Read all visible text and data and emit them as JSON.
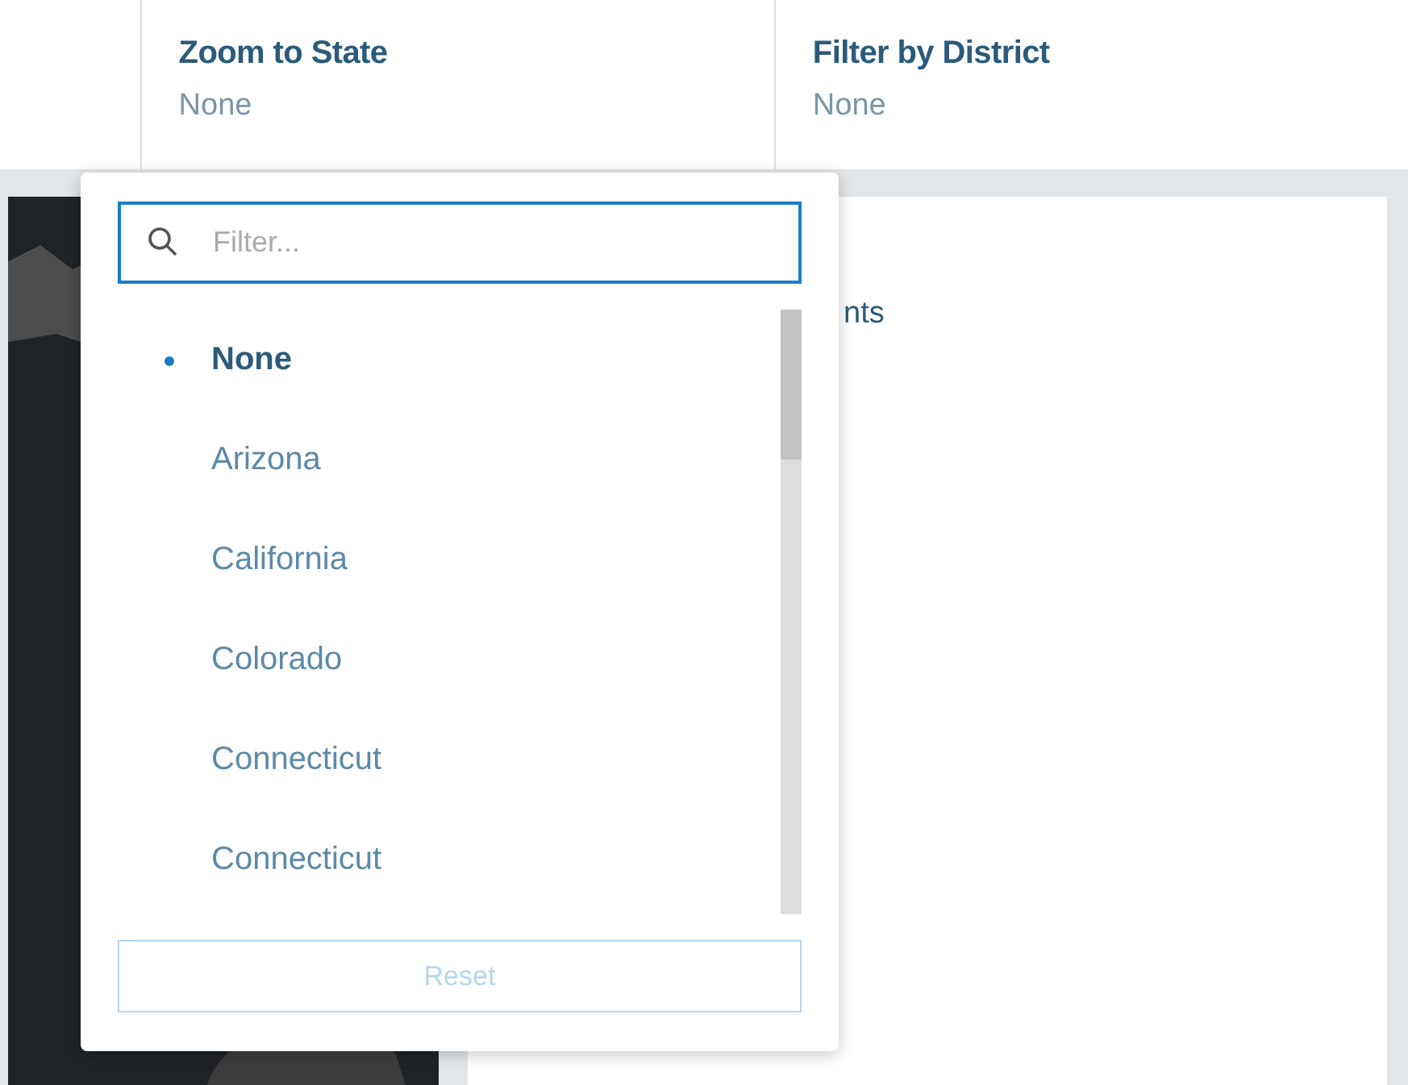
{
  "filters": [
    {
      "label": "Zoom to State",
      "value": "None"
    },
    {
      "label": "Filter by District",
      "value": "None"
    }
  ],
  "panel_text": "nts",
  "dropdown": {
    "search": {
      "placeholder": "Filter..."
    },
    "options": [
      {
        "label": "None",
        "selected": true
      },
      {
        "label": "Arizona",
        "selected": false
      },
      {
        "label": "California",
        "selected": false
      },
      {
        "label": "Colorado",
        "selected": false
      },
      {
        "label": "Connecticut",
        "selected": false
      },
      {
        "label": "Connecticut",
        "selected": false
      }
    ],
    "reset": {
      "label": "Reset",
      "disabled": true
    }
  }
}
